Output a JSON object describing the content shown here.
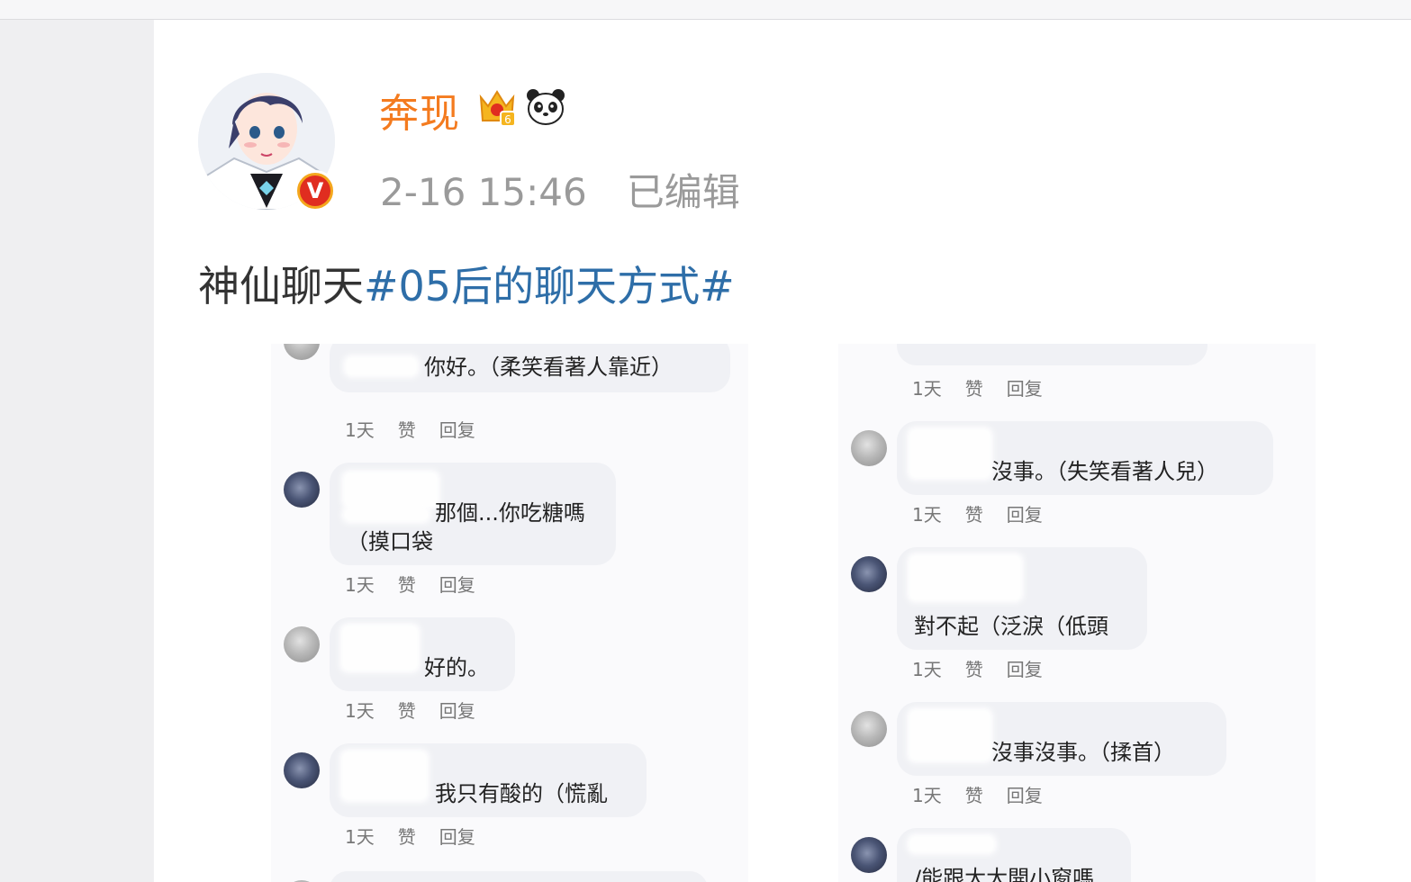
{
  "post": {
    "username": "奔现",
    "timestamp": "2-16 15:46",
    "edited_label": "已编辑",
    "text_prefix": "神仙聊天",
    "topic": "#05后的聊天方式#",
    "icons": [
      "crown-level-6-icon",
      "panda-icon",
      "verified-v-icon"
    ],
    "verified_letter": "V",
    "colors": {
      "username": "#f47b1f",
      "topic": "#2e6ea8",
      "meta": "#9a9a9a"
    }
  },
  "embedded_comments": {
    "left": [
      {
        "lines": [
          "你好。（柔笑看著人靠近）"
        ],
        "time": "1天",
        "like": "赞",
        "reply": "回复"
      },
      {
        "lines": [
          "那個...你吃糖嗎",
          "（摸口袋"
        ],
        "time": "1天",
        "like": "赞",
        "reply": "回复"
      },
      {
        "lines": [
          "好的。"
        ],
        "time": "1天",
        "like": "赞",
        "reply": "回复"
      },
      {
        "lines": [
          "我只有酸的（慌亂"
        ],
        "time": "1天",
        "like": "赞",
        "reply": "回复"
      }
    ],
    "right": [
      {
        "lines": [],
        "time": "1天",
        "like": "赞",
        "reply": "回复"
      },
      {
        "lines": [
          "沒事。（失笑看著人兒）"
        ],
        "time": "1天",
        "like": "赞",
        "reply": "回复"
      },
      {
        "lines": [
          "對不起（泛淚（低頭"
        ],
        "time": "1天",
        "like": "赞",
        "reply": "回复"
      },
      {
        "lines": [
          "沒事沒事。（揉首）"
        ],
        "time": "1天",
        "like": "赞",
        "reply": "回复"
      },
      {
        "lines": [
          "/能跟大大開小窗嗎"
        ]
      }
    ]
  }
}
